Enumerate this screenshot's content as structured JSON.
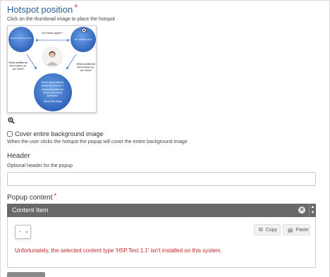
{
  "hotspot": {
    "title": "Hotspot position",
    "required_mark": "*",
    "description": "Click on the thumbnail image to place the hotspot",
    "thumbnail": {
      "top_question": "Do these agree?",
      "left_circle": "Statutory assessments",
      "right_circle": "Non-statutory tests",
      "left_text": [
        "What additional",
        "information do",
        "we need?"
      ],
      "right_text": [
        "What additional",
        "information do",
        "we need?"
      ],
      "bottom_circle": [
        "Other observations",
        "about the learner ?",
        "About educational",
        "and/or personal",
        "contexts?",
        "About the tasks"
      ]
    },
    "zoom_icon": "zoom-in-icon"
  },
  "cover": {
    "label": "Cover entire background image",
    "description": "When the user clicks the hotspot the popup will cover the entire background image",
    "checked": false
  },
  "header_field": {
    "label": "Header",
    "description": "Optional header for the popup",
    "value": ""
  },
  "popup": {
    "label": "Popup content",
    "required_mark": "*",
    "content_item": {
      "title": "Content Item",
      "close_icon": "close-icon",
      "up_icon": "chevron-up-icon",
      "down_icon": "chevron-down-icon",
      "select_value": "-",
      "copy_label": "Copy",
      "paste_label": "Paste",
      "error": "Unfortunately, the selected content type 'H5P.Text 1.1' isn't installed on this system."
    }
  },
  "colors": {
    "title": "#2e5f93",
    "required": "#d63b3b",
    "bar": "#696969",
    "error": "#c0262b",
    "circle": "#3c73c7"
  }
}
